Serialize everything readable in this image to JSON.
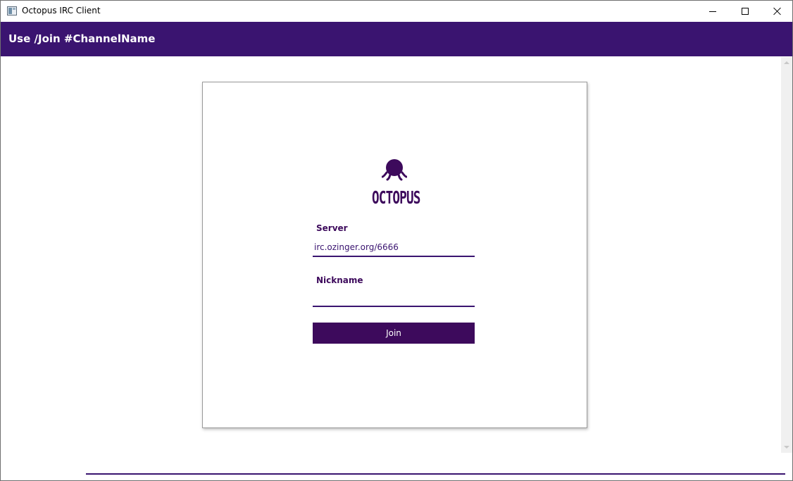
{
  "window": {
    "title": "Octopus IRC Client"
  },
  "header": {
    "title": "Use /Join #ChannelName"
  },
  "login": {
    "logo_text": "OCTOPUS",
    "server_label": "Server",
    "server_value": "irc.ozinger.org/6666",
    "nickname_label": "Nickname",
    "nickname_value": "",
    "join_label": "Join"
  },
  "colors": {
    "header_bg": "#3a1470",
    "accent": "#3d0a5c"
  },
  "icons": {
    "app": "app-window-icon",
    "logo": "octopus-logo-icon",
    "minimize": "minimize-icon",
    "maximize": "maximize-icon",
    "close": "close-icon"
  }
}
